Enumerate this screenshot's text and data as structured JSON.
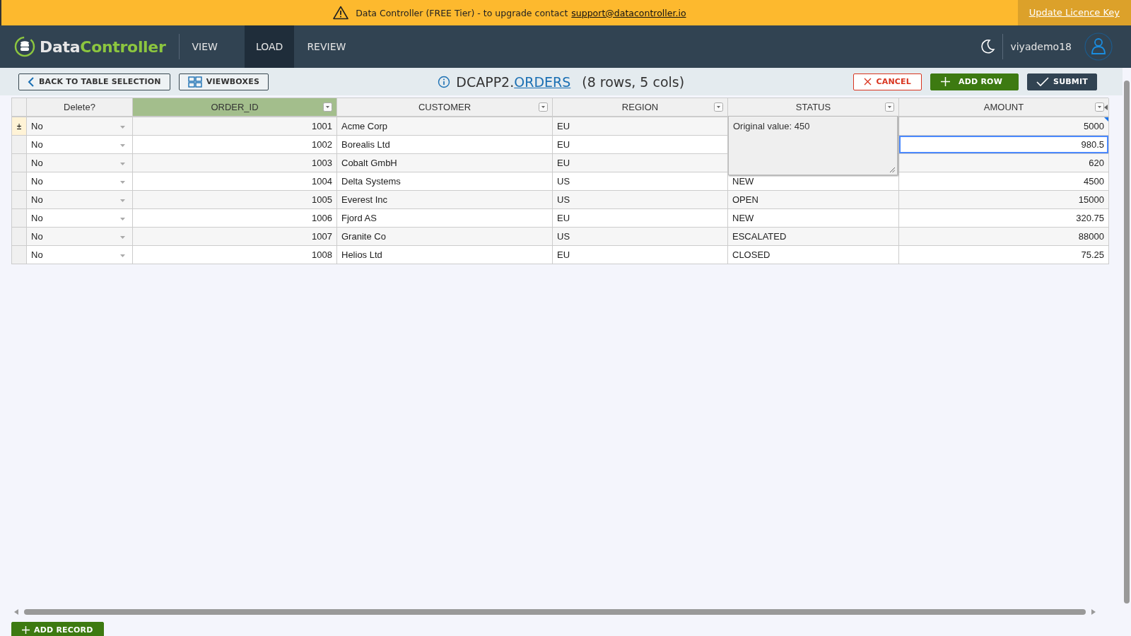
{
  "banner": {
    "message": "Data Controller (FREE Tier) - to upgrade contact",
    "link": "support@datacontroller.io",
    "action": "Update Licence Key"
  },
  "nav": {
    "logo_first": "Data",
    "logo_second": "Controller",
    "tabs": [
      {
        "label": "VIEW",
        "selected": false
      },
      {
        "label": "LOAD",
        "selected": true
      },
      {
        "label": "REVIEW",
        "selected": false
      }
    ],
    "user": "viyademo18"
  },
  "toolbar": {
    "back": "BACK TO TABLE SELECTION",
    "viewboxes": "VIEWBOXES",
    "library": "DCAPP2.",
    "table": "ORDERS",
    "summary": "(8 rows, 5 cols)",
    "cancel": "CANCEL",
    "add_row": "ADD ROW",
    "submit": "SUBMIT"
  },
  "table": {
    "columns": [
      {
        "label": "Delete?",
        "selected": false,
        "filter": false,
        "kind": "select"
      },
      {
        "label": "ORDER_ID",
        "selected": true,
        "filter": true,
        "kind": "number"
      },
      {
        "label": "CUSTOMER",
        "selected": false,
        "filter": true,
        "kind": "text"
      },
      {
        "label": "REGION",
        "selected": false,
        "filter": true,
        "kind": "text"
      },
      {
        "label": "STATUS",
        "selected": false,
        "filter": true,
        "kind": "text"
      },
      {
        "label": "AMOUNT",
        "selected": false,
        "filter": true,
        "kind": "number"
      }
    ],
    "rows": [
      {
        "marker": "±",
        "cells": [
          "No",
          "1001",
          "Acme Corp",
          "EU",
          null,
          "5000"
        ],
        "amount_selected": false,
        "amount_commented": true
      },
      {
        "cells": [
          "No",
          "1002",
          "Borealis Ltd",
          "EU",
          null,
          "980.5"
        ],
        "amount_selected": true,
        "amount_commented": false
      },
      {
        "cells": [
          "No",
          "1003",
          "Cobalt GmbH",
          "EU",
          null,
          "620"
        ],
        "amount_selected": false,
        "amount_commented": false
      },
      {
        "cells": [
          "No",
          "1004",
          "Delta Systems",
          "US",
          "NEW",
          "4500"
        ],
        "amount_selected": false,
        "amount_commented": false
      },
      {
        "cells": [
          "No",
          "1005",
          "Everest Inc",
          "US",
          "OPEN",
          "15000"
        ],
        "amount_selected": false,
        "amount_commented": false
      },
      {
        "cells": [
          "No",
          "1006",
          "Fjord AS",
          "EU",
          "NEW",
          "320.75"
        ],
        "amount_selected": false,
        "amount_commented": false
      },
      {
        "cells": [
          "No",
          "1007",
          "Granite Co",
          "US",
          "ESCALATED",
          "88000"
        ],
        "amount_selected": false,
        "amount_commented": false
      },
      {
        "cells": [
          "No",
          "1008",
          "Helios Ltd",
          "EU",
          "CLOSED",
          "75.25"
        ],
        "amount_selected": false,
        "amount_commented": false
      }
    ],
    "comment": "Original value: 450"
  },
  "footer": {
    "add_record": "ADD RECORD"
  }
}
